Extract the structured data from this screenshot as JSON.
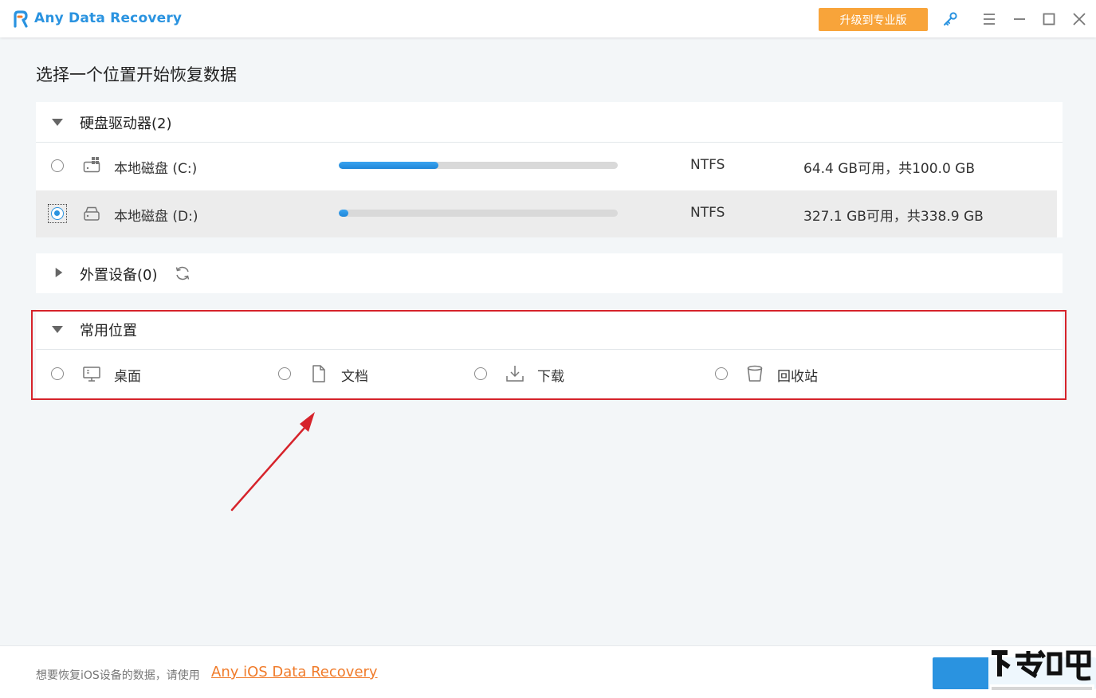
{
  "app": {
    "title": "Any Data Recovery",
    "brand_color": "#2a93e0",
    "upgrade_label": "升级到专业版",
    "upgrade_color": "#f8a43a",
    "icons": [
      "key-icon",
      "menu-icon",
      "minimize-icon",
      "maximize-icon",
      "close-icon"
    ]
  },
  "main": {
    "heading": "选择一个位置开始恢复数据",
    "hard_drives": {
      "label": "硬盘驱动器(2)",
      "expanded": true,
      "drives": [
        {
          "name": "本地磁盘 (C:)",
          "fs": "NTFS",
          "capacity": "64.4 GB可用，共100.0 GB",
          "used_fraction": 0.356,
          "selected": false,
          "icon": "windows-drive-icon"
        },
        {
          "name": "本地磁盘 (D:)",
          "fs": "NTFS",
          "capacity": "327.1 GB可用，共338.9 GB",
          "used_fraction": 0.035,
          "selected": true,
          "icon": "drive-icon"
        }
      ]
    },
    "external": {
      "label": "外置设备(0)",
      "expanded": false
    },
    "common": {
      "label": "常用位置",
      "expanded": true,
      "items": [
        {
          "label": "桌面",
          "icon": "desktop-icon"
        },
        {
          "label": "文档",
          "icon": "document-icon"
        },
        {
          "label": "下载",
          "icon": "download-icon"
        },
        {
          "label": "回收站",
          "icon": "recycle-bin-icon"
        }
      ]
    }
  },
  "footer": {
    "text": "想要恢复iOS设备的数据，请使用",
    "link": "Any iOS Data Recovery",
    "link_color": "#f07b2a"
  },
  "annotation": {
    "highlight_color": "#d6232b"
  }
}
